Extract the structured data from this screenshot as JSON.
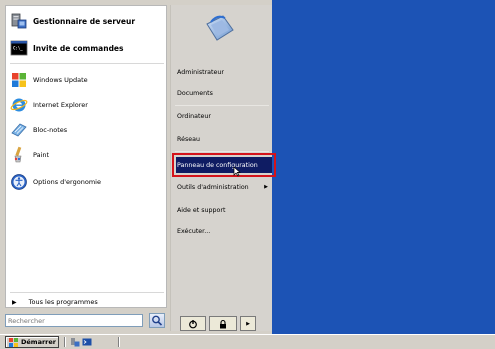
{
  "start_menu": {
    "pinned": [
      {
        "label": "Gestionnaire de serveur",
        "icon": "server-manager-icon"
      },
      {
        "label": "Invite de commandes",
        "icon": "command-prompt-icon"
      }
    ],
    "programs": [
      {
        "label": "Windows Update",
        "icon": "windows-update-icon"
      },
      {
        "label": "Internet Explorer",
        "icon": "internet-explorer-icon"
      },
      {
        "label": "Bloc-notes",
        "icon": "notepad-icon"
      },
      {
        "label": "Paint",
        "icon": "paint-icon"
      },
      {
        "label": "Options d'ergonomie",
        "icon": "accessibility-icon"
      }
    ],
    "all_programs": "Tous les programmes",
    "search_placeholder": "Rechercher",
    "right_items": [
      {
        "label": "Administrateur"
      },
      {
        "label": "Documents"
      },
      {
        "label": "Ordinateur"
      },
      {
        "label": "Réseau"
      },
      {
        "label": "Panneau de configuration",
        "highlighted": true
      },
      {
        "label": "Outils d'administration",
        "submenu": true
      },
      {
        "label": "Aide et support"
      },
      {
        "label": "Exécuter..."
      }
    ]
  },
  "taskbar": {
    "start_label": "Démarrer"
  },
  "colors": {
    "desktop": "#1c53b5",
    "highlight": "#0f1c63",
    "highlight_outline": "#d4131b",
    "menu_bg": "#d4d0c8"
  }
}
